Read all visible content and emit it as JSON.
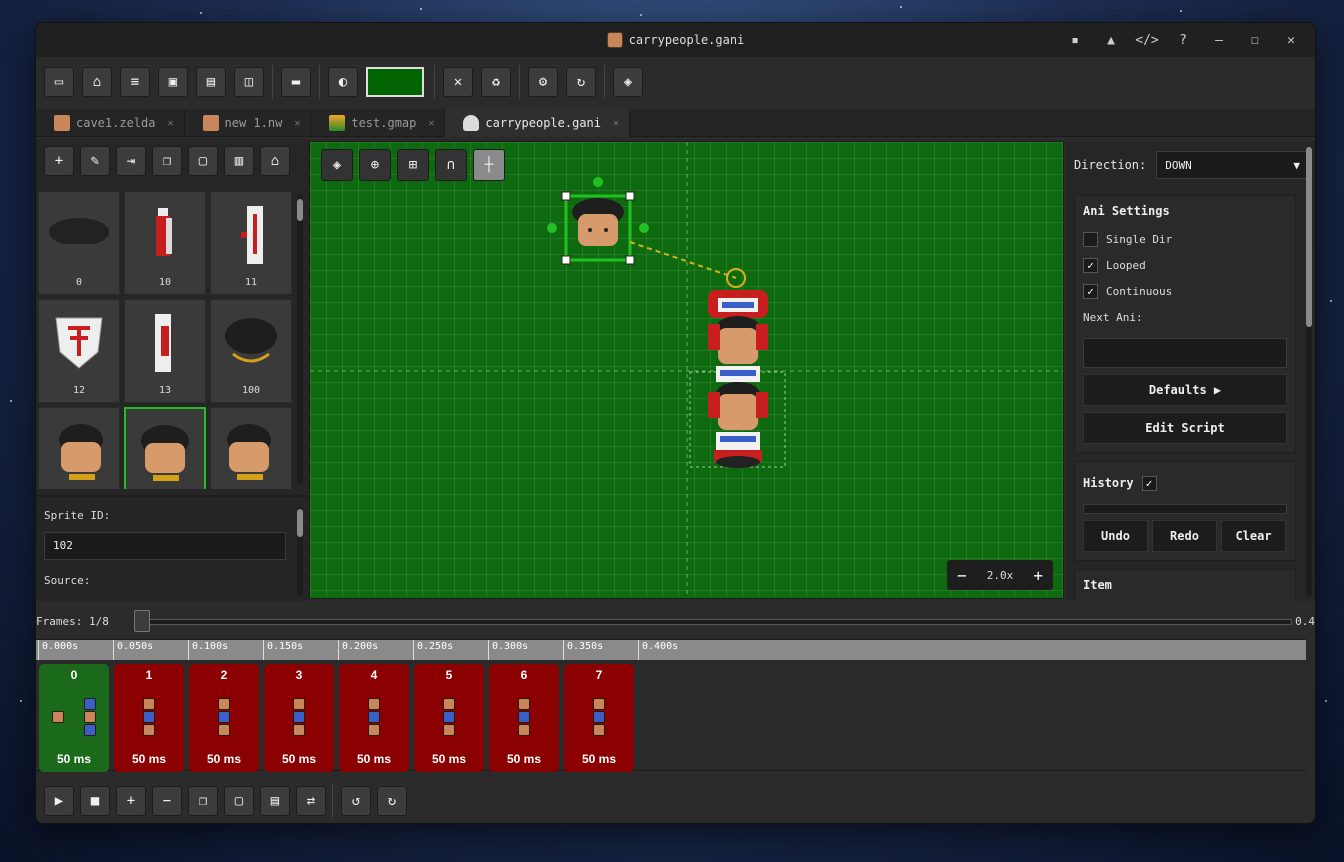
{
  "window": {
    "title": "carrypeople.gani"
  },
  "window_controls": [
    "minimize",
    "maximize",
    "close"
  ],
  "toolbar": {
    "color_value": "#006400",
    "buttons": [
      "new-file",
      "open-folder",
      "document",
      "save",
      "save-as",
      "save-all",
      "folder",
      "palette",
      "close",
      "recycle",
      "settings",
      "refresh",
      "layers"
    ]
  },
  "tabs": [
    {
      "label": "cave1.zelda",
      "active": false
    },
    {
      "label": "new 1.nw",
      "active": false
    },
    {
      "label": "test.gmap",
      "active": false
    },
    {
      "label": "carrypeople.gani",
      "active": true
    }
  ],
  "left_panel": {
    "sprites": [
      {
        "id": "0"
      },
      {
        "id": "10"
      },
      {
        "id": "11"
      },
      {
        "id": "12"
      },
      {
        "id": "13"
      },
      {
        "id": "100"
      },
      {
        "id": ""
      },
      {
        "id": "",
        "selected": true
      },
      {
        "id": ""
      }
    ],
    "props": {
      "sprite_id_label": "Sprite ID:",
      "sprite_id_value": "102",
      "source_label": "Source:"
    }
  },
  "canvas": {
    "zoom": "2.0x"
  },
  "right_panel": {
    "direction_label": "Direction:",
    "direction_value": "DOWN",
    "ani_settings": {
      "title": "Ani Settings",
      "single_dir": {
        "label": "Single Dir",
        "checked": false
      },
      "looped": {
        "label": "Looped",
        "checked": true
      },
      "continuous": {
        "label": "Continuous",
        "checked": true
      },
      "next_ani_label": "Next Ani:",
      "defaults_btn": "Defaults ▶",
      "edit_script_btn": "Edit Script"
    },
    "history": {
      "title": "History",
      "checked": true,
      "undo": "Undo",
      "redo": "Redo",
      "clear": "Clear"
    },
    "item_title": "Item"
  },
  "frames": {
    "label": "Frames: 1/8",
    "end_value": "0.4"
  },
  "timeline": {
    "ticks": [
      "0.000s",
      "0.050s",
      "0.100s",
      "0.150s",
      "0.200s",
      "0.250s",
      "0.300s",
      "0.350s",
      "0.400s"
    ],
    "frames": [
      {
        "index": "0",
        "duration": "50 ms",
        "active": true
      },
      {
        "index": "1",
        "duration": "50 ms"
      },
      {
        "index": "2",
        "duration": "50 ms"
      },
      {
        "index": "3",
        "duration": "50 ms"
      },
      {
        "index": "4",
        "duration": "50 ms"
      },
      {
        "index": "5",
        "duration": "50 ms"
      },
      {
        "index": "6",
        "duration": "50 ms"
      },
      {
        "index": "7",
        "duration": "50 ms"
      }
    ]
  },
  "colors": {
    "canvas_bg": "#0e6a0e",
    "frame_active": "#1b6a1b",
    "frame_inactive": "#8b0000",
    "selection": "#22c022"
  }
}
